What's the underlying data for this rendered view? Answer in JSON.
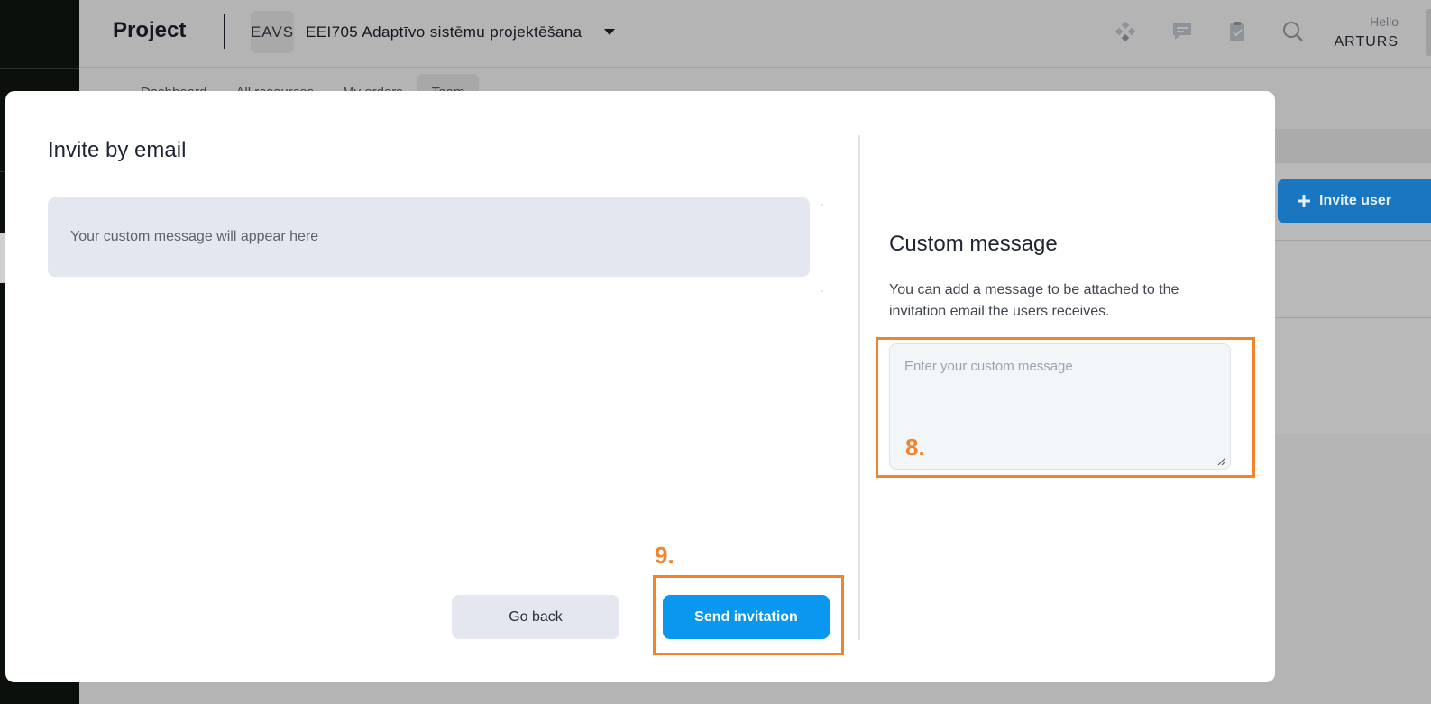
{
  "header": {
    "brand": "Project",
    "project_code": "EAVS",
    "project_name": "EEI705 Adaptīvo sistēmu projektēšana",
    "greeting": "Hello",
    "user_name": "ARTURS",
    "icons": [
      "apps-icon",
      "chat-icon",
      "clipboard-check-icon",
      "search-icon"
    ]
  },
  "tabs": [
    {
      "label": "Dashboard"
    },
    {
      "label": "All resources"
    },
    {
      "label": "My orders"
    },
    {
      "label": "Team",
      "active": true
    }
  ],
  "background": {
    "invite_user_label": "Invite user"
  },
  "modal": {
    "title": "Invite by email",
    "preview_text": "Your custom message will appear here",
    "custom_message": {
      "title": "Custom message",
      "description": "You can add a message to be attached to the invitation email the users receives.",
      "placeholder": "Enter your custom message",
      "value": ""
    },
    "buttons": {
      "back": "Go back",
      "send": "Send invitation"
    }
  },
  "annotations": {
    "step_message": "8.",
    "step_send": "9.",
    "color": "#f2832a"
  },
  "colors": {
    "primary": "#0a97f0",
    "sidebar": "#0c100d",
    "overlay_bg": "#b4b4b4"
  }
}
